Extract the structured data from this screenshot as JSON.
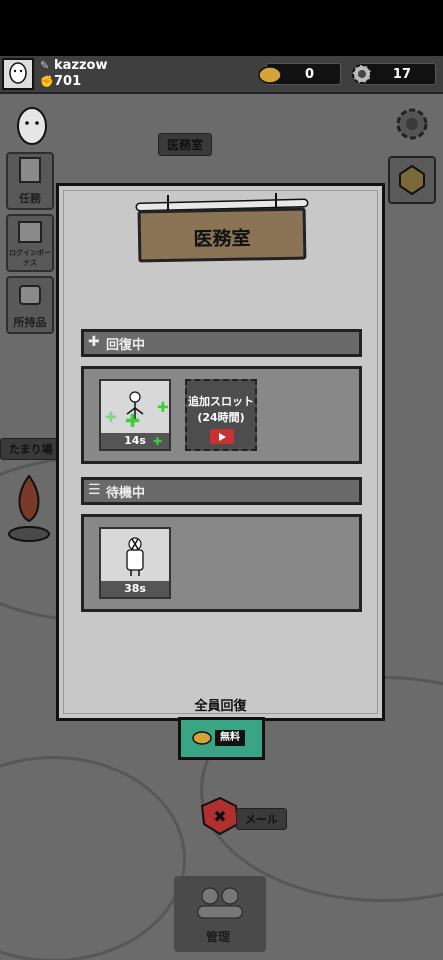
{
  "player": {
    "name": "kazzow",
    "score": "701"
  },
  "currency": {
    "gold": "0",
    "gear": "17"
  },
  "map_labels": {
    "infirmary": "医務室",
    "bonfire": "たまり場",
    "mail": "メール",
    "manage": "管理"
  },
  "sidebar": [
    {
      "label": "任務",
      "icon": "clipboard-icon"
    },
    {
      "label": "ログインボーナス",
      "icon": "calendar-icon"
    },
    {
      "label": "所持品",
      "icon": "bag-icon"
    }
  ],
  "modal": {
    "title": "医務室",
    "recovering_header": "回復中",
    "waiting_header": "待機中",
    "recovering_slot_timer": "14s",
    "add_slot_title": "追加スロット",
    "add_slot_sub": "(24時間)",
    "waiting_slot_timer": "38s",
    "heal_all_label": "全員回復",
    "heal_all_free": "無料"
  },
  "colors": {
    "modal_bg": "#c8c8c8",
    "heal_button": "#3aa585",
    "plus_green": "#3ccf3c",
    "video_red": "#c83232"
  }
}
